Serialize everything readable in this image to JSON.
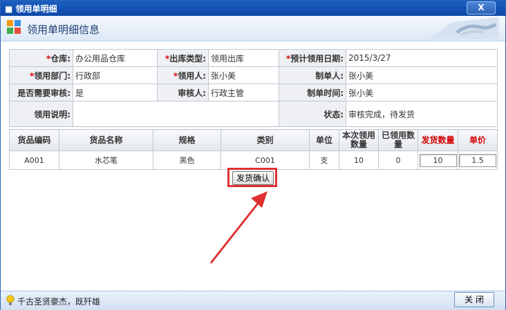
{
  "window": {
    "title": "领用单明细",
    "close_label": "X"
  },
  "header": {
    "title": "领用单明细信息"
  },
  "form": {
    "warehouse_label": "仓库:",
    "warehouse_value": "办公用品仓库",
    "out_type_label": "出库类型:",
    "out_type_value": "领用出库",
    "expected_date_label": "预计领用日期:",
    "expected_date_value": "2015/3/27",
    "dept_label": "领用部门:",
    "dept_value": "行政部",
    "receiver_label": "领用人:",
    "receiver_value": "张小美",
    "creator_label": "制单人:",
    "creator_value": "张小美",
    "need_review_label": "是否需要审核:",
    "need_review_value": "是",
    "reviewer_label": "审核人:",
    "reviewer_value": "行政主管",
    "create_time_label": "制单时间:",
    "create_time_value": "张小美",
    "desc_label": "领用说明:",
    "desc_value": "",
    "status_label": "状态:",
    "status_value": "审核完成，待发货"
  },
  "grid": {
    "headers": [
      "货品编码",
      "货品名称",
      "规格",
      "类别",
      "单位",
      "本次领用数量",
      "已领用数量",
      "发货数量",
      "单价"
    ],
    "rows": [
      {
        "code": "A001",
        "name": "水芯笔",
        "spec": "黑色",
        "category": "C001",
        "unit": "支",
        "this_qty": "10",
        "used_qty": "0",
        "ship_qty": "10",
        "price": "1.5"
      }
    ]
  },
  "actions": {
    "confirm_label": "发货确认",
    "close_label": "关 闭"
  },
  "status_bar": {
    "tip": "千古圣贤豪杰，既歼雄"
  }
}
